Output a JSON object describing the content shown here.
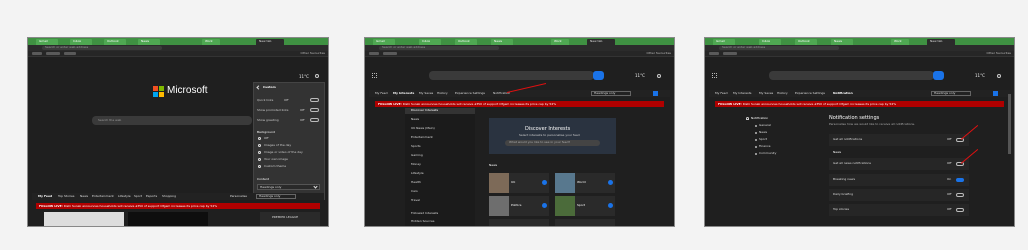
{
  "frames": [
    {
      "tabs": [
        {
          "label": "Gmail"
        },
        {
          "label": "Inbox"
        },
        {
          "label": "Outlook"
        },
        {
          "label": "News"
        },
        {
          "label": "Work"
        },
        {
          "label": "New tab"
        }
      ],
      "address_placeholder": "Search or enter web address",
      "other_favourites": "Other favourites",
      "weather": "11°C",
      "logo_text": "Microsoft",
      "search_placeholder": "Search the web",
      "custom_panel": {
        "title": "Custom",
        "rows": [
          {
            "label": "Quick links",
            "value": "Off"
          },
          {
            "label": "Show promoted links",
            "value": "Off"
          },
          {
            "label": "Show greeting",
            "value": "Off"
          }
        ],
        "background_title": "Background",
        "background_options": [
          "Off",
          "Images of the day",
          "Image or video of the day",
          "Your own image",
          "Custom theme"
        ],
        "content_title": "Content",
        "content_value": "Headings only"
      },
      "feed_nav": [
        "My Feed",
        "Top Stories",
        "News",
        "Entertainment",
        "Lifestyle",
        "Sport",
        "Esports",
        "Shopping"
      ],
      "personalise": "Personalise",
      "headings_select": "Headings only",
      "banner_bold": "FOLLOW LIVE:",
      "banner_text": "Rishi Sunak announces households will receive £350 of support Ofgem increases its price cap by 54%",
      "premier_label": "PREMIER LEAGUE"
    },
    {
      "tabs": [
        {
          "label": "Gmail"
        },
        {
          "label": "Inbox"
        },
        {
          "label": "Outlook"
        },
        {
          "label": "News"
        },
        {
          "label": "Work"
        },
        {
          "label": "New tab"
        }
      ],
      "address_placeholder": "Search or enter web address",
      "other_favourites": "Other favourites",
      "weather": "11°C",
      "nav": [
        "My Feed",
        "My Interests",
        "My Saves",
        "History",
        "Experience Settings",
        "Notification"
      ],
      "headings_select": "Headings only",
      "banner_bold": "FOLLOW LIVE:",
      "banner_text": "Rishi Sunak announces households will receive £350 of support Ofgem increases its price cap by 54%",
      "sidebar": [
        "Discover Interests",
        "News",
        "UK News (Main)",
        "Entertainment",
        "Sports",
        "Gaming",
        "Money",
        "Lifestyle",
        "Health",
        "Cars",
        "Travel"
      ],
      "sidebar_bottom": [
        "Followed Interests",
        "Hidden Sources"
      ],
      "discover_title": "Discover Interests",
      "discover_sub": "Select interests to personalise your feed",
      "discover_search": "What would you like to see in your feed?",
      "news_label": "News",
      "tiles": [
        "UK",
        "World",
        "Politics",
        "Sport"
      ]
    },
    {
      "tabs": [
        {
          "label": "Gmail"
        },
        {
          "label": "Inbox"
        },
        {
          "label": "Outlook"
        },
        {
          "label": "News"
        },
        {
          "label": "Work"
        },
        {
          "label": "New tab"
        }
      ],
      "address_placeholder": "Search or enter web address",
      "other_favourites": "Other favourites",
      "weather": "11°C",
      "nav": [
        "My Feed",
        "My Interests",
        "My Saves",
        "History",
        "Experience Settings",
        "Notification"
      ],
      "headings_select": "Headings only",
      "banner_bold": "FOLLOW LIVE:",
      "banner_text": "Rishi Sunak announces households will receive £350 of support Ofgem increases its price cap by 54%",
      "sidebar": [
        "Notification",
        "General",
        "News",
        "Sport",
        "Finance",
        "Community"
      ],
      "settings_title": "Notification settings",
      "settings_sub": "Personalise how we would like to receive all notifications.",
      "settings": [
        {
          "label": "Get all notifications",
          "value": "Off"
        },
        {
          "label": "Get all news notifications",
          "value": "Off",
          "section": "News"
        },
        {
          "label": "Breaking news",
          "value": "On"
        },
        {
          "label": "Daily briefing",
          "value": "Off"
        },
        {
          "label": "Top stories",
          "value": "Off"
        }
      ]
    }
  ],
  "colors": {
    "accent": "#1a73e8",
    "banner": "#b00000",
    "tabbar": "#3f9142",
    "arrow": "#e01010"
  }
}
